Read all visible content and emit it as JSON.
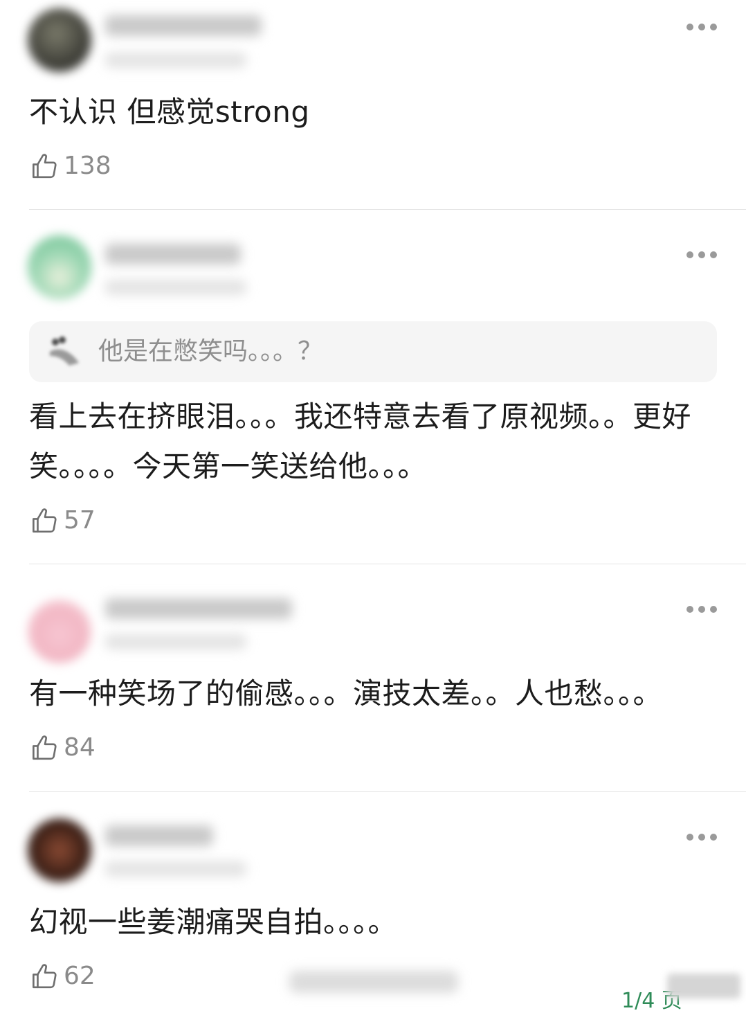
{
  "comments": [
    {
      "text": "不认识 但感觉strong",
      "likes": "138",
      "avatar_colors": [
        "#3b3b35",
        "#6f6f60"
      ]
    },
    {
      "quote": "他是在憋笑吗。。。？",
      "text": "看上去在挤眼泪。。。我还特意去看了原视频。。更好笑。。。。今天第一笑送给他。。。",
      "likes": "57",
      "avatar_colors": [
        "#7cc7a0",
        "#cfe8d6"
      ]
    },
    {
      "text": "有一种笑场了的偷感。。。演技太差。。人也愁。。。",
      "likes": "84",
      "avatar_colors": [
        "#f2b7c4",
        "#fbe3e8"
      ]
    },
    {
      "text": "幻视一些姜潮痛哭自拍。。。。",
      "likes": "62",
      "avatar_colors": [
        "#3a1e15",
        "#7a3b2a"
      ]
    }
  ],
  "footer": {
    "page_indicator": "1/4 页"
  },
  "colors": {
    "text": "#1c1c1c",
    "meta": "#8a8a8a",
    "divider": "#e4e4e4",
    "quote_bg": "#f5f5f5",
    "page_indicator": "#2e8b57"
  },
  "icons": {
    "like": "thumbs-up-outline-icon",
    "more": "more-horizontal-icon"
  }
}
